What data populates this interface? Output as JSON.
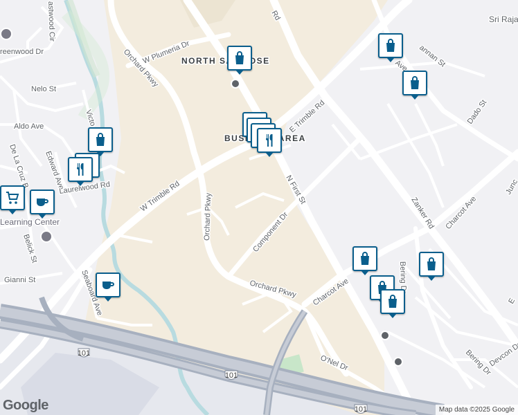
{
  "labels": {
    "area_north": "NORTH SAN JOSE",
    "area_business": "BUSINESS AREA",
    "sri_raja": "Sri Raja",
    "learning_center": "Learning Center"
  },
  "streets": {
    "w_plumeria": "W Plumeria Dr",
    "orchard_top": "Orchard Pkwy",
    "orchard_vertical": "Orchard Pkwy",
    "orchard_bottom": "Orchard Pkwy",
    "e_trimble": "E Trimble Rd",
    "w_trimble": "W Trimble Rd",
    "n_first": "N First St",
    "component": "Component Dr",
    "charcot_left": "Charcot Ave",
    "charcot_right": "Charcot Ave",
    "zanker": "Zanker Rd",
    "onel": "O'Nel Dr",
    "bering_top": "Bering Dr",
    "bering_bottom": "Bering Dr",
    "devcon": "Devcon Dr",
    "dado": "Dado St",
    "junction": "Junc",
    "bannan": "annan St",
    "nelo": "Nelo St",
    "aldo": "Aldo Ave",
    "edward": "Edward Ave",
    "laurelwood": "Laurelwood Rd",
    "delacruz": "De La Cruz B",
    "belick": "Belick St",
    "gianni": "Gianni St",
    "seaboard": "Seaboard Ave",
    "victor": "Victo",
    "greenwood": "reenwood Dr",
    "eastwood": "astwood Cir",
    "airport_e": "E",
    "north_rd": "Rd",
    "j_ave": "Ave",
    "hwy_101_a": "101",
    "hwy_101_b": "101",
    "hwy_101_c": "101",
    "hwy_101_d": "101"
  },
  "markers": [
    {
      "icon": "shopping-bag-icon"
    },
    {
      "icon": "shopping-bag-icon"
    },
    {
      "icon": "shopping-bag-icon"
    },
    {
      "icon": "shopping-bag-icon"
    },
    {
      "icon": "restaurant-icon"
    },
    {
      "icon": "restaurant-icon"
    },
    {
      "icon": "restaurant-icon"
    },
    {
      "icon": "restaurant-icon"
    },
    {
      "icon": "shopping-bag-icon"
    },
    {
      "icon": "restaurant-icon"
    },
    {
      "icon": "shopping-cart-icon"
    },
    {
      "icon": "coffee-cup-icon"
    },
    {
      "icon": "coffee-cup-icon"
    },
    {
      "icon": "shopping-bag-icon"
    },
    {
      "icon": "shopping-bag-icon"
    },
    {
      "icon": "shopping-bag-icon"
    },
    {
      "icon": "shopping-bag-icon"
    }
  ],
  "attribution": {
    "logo": "Google",
    "text": "Map data ©2025 Google"
  },
  "colors": {
    "marker_border": "#0a5e8c",
    "road": "#ffffff",
    "highway": "#8a96a8",
    "water": "#aadaff",
    "park": "#c8e6c9",
    "commercial": "#f3ecde"
  }
}
